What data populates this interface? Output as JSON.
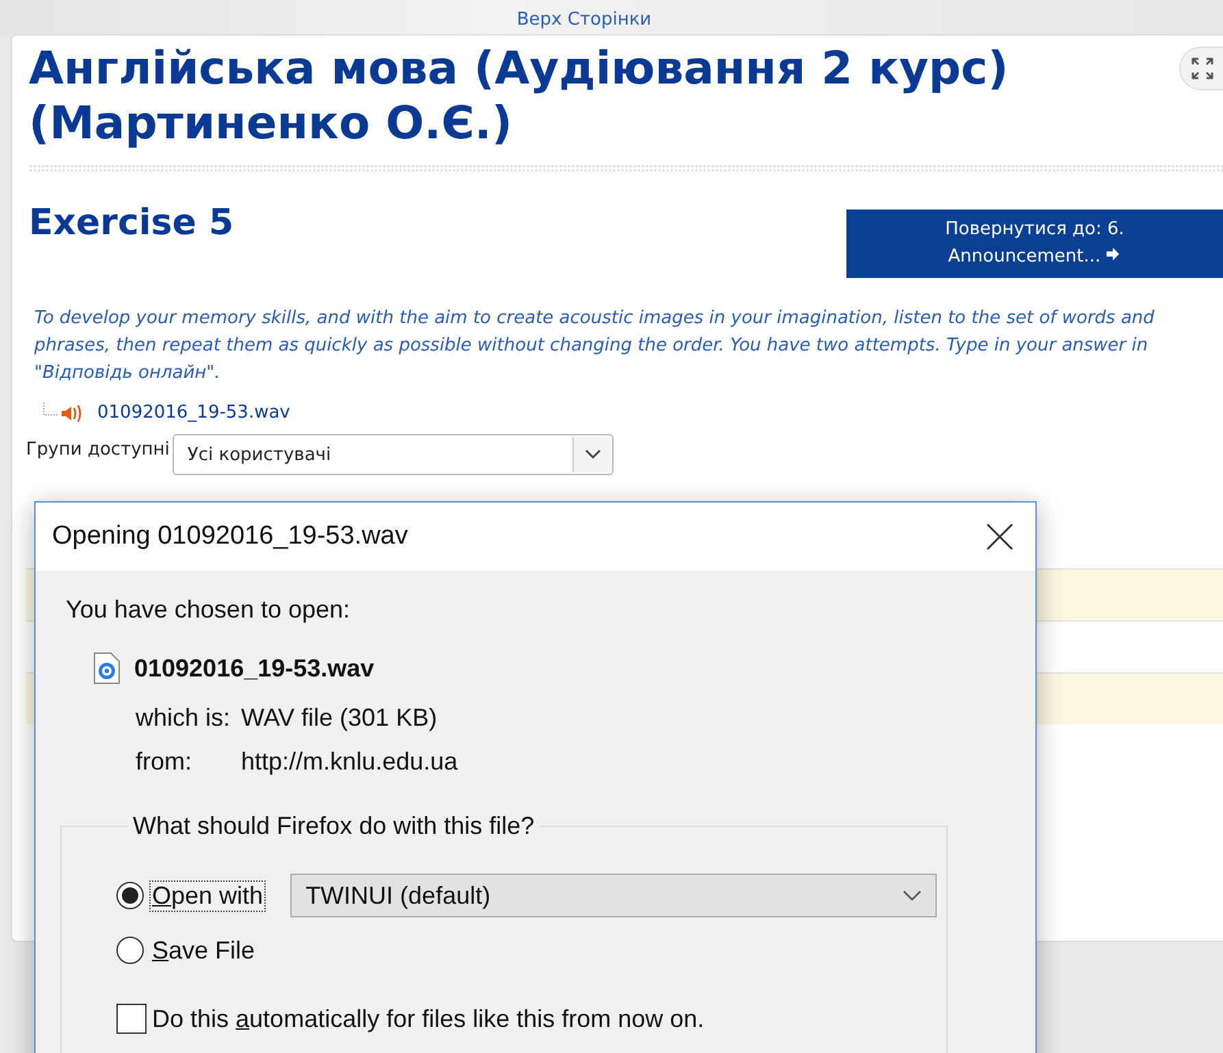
{
  "page": {
    "top_link": "Верх Сторінки",
    "course_title": "Англійська мова (Аудіювання 2 курс) (Мартиненко О.Є.)",
    "activity_title": "Exercise 5",
    "return_button": {
      "line_1": "Повернутися до: 6.",
      "line_2": "Announcement..."
    },
    "description": "To develop your memory skills, and with the aim to create acoustic images in your imagination,  listen to the set of words and phrases, then repeat them as quickly as possible without changing the order. You have two attempts. Type in your answer in \"Відповідь онлайн\".",
    "file_link": "01092016_19-53.wav",
    "groups": {
      "label": "Групи доступні",
      "value": "Усі користувачі"
    }
  },
  "dialog": {
    "title": "Opening 01092016_19-53.wav",
    "intro": "You have chosen to open:",
    "file_name": "01092016_19-53.wav",
    "which_is": {
      "label": "which is:",
      "value": "WAV file (301 KB)"
    },
    "from": {
      "label": "from:",
      "value": "http://m.knlu.edu.ua"
    },
    "question": "What should Firefox do with this file?",
    "options": [
      {
        "kind": "open_with",
        "key": "O",
        "post": "pen with",
        "selected": true,
        "app": "TWINUI (default)"
      },
      {
        "kind": "save",
        "key": "S",
        "post": "ave File",
        "selected": false
      }
    ],
    "auto_checkbox": {
      "pre": "Do this ",
      "key": "a",
      "post": "utomatically for files like this from now on.",
      "checked": false
    }
  }
}
